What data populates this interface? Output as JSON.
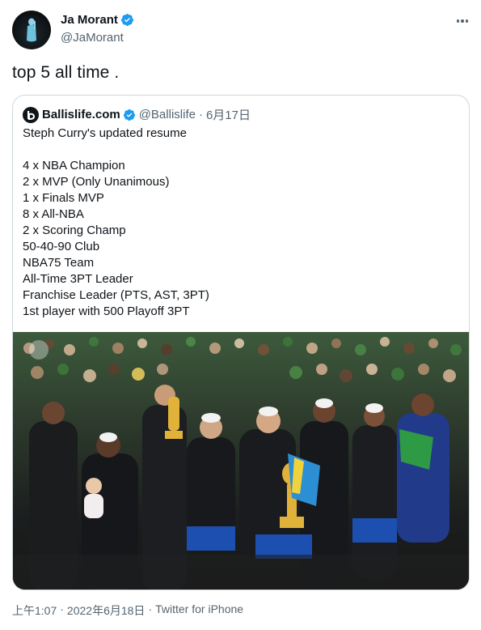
{
  "tweet": {
    "display_name": "Ja Morant",
    "handle": "@JaMorant",
    "text": "top 5 all time .",
    "more_icon": "more-horizontal-icon",
    "verified_icon": "verified-badge-icon"
  },
  "quote": {
    "display_name": "Ballislife.com",
    "handle": "@Ballislife",
    "separator": "·",
    "date": "6月17日",
    "lines": [
      "Steph Curry's updated resume",
      "",
      "4 x NBA Champion",
      "2 x MVP (Only Unanimous)",
      "1 x Finals MVP",
      "8 x All-NBA",
      "2 x Scoring Champ",
      "50-40-90 Club",
      "NBA75 Team",
      "All-Time 3PT Leader",
      "Franchise Leader (PTS, AST, 3PT)",
      "1st player with 500 Playoff 3PT"
    ],
    "media_icon": "championship-celebration-photo"
  },
  "footer": {
    "time": "上午1:07",
    "separator": "·",
    "date": "2022年6月18日",
    "separator2": "·",
    "source": "Twitter for iPhone"
  },
  "colors": {
    "text": "#0f1419",
    "muted": "#536471",
    "border": "#cfd9de",
    "verified": "#1d9bf0"
  }
}
